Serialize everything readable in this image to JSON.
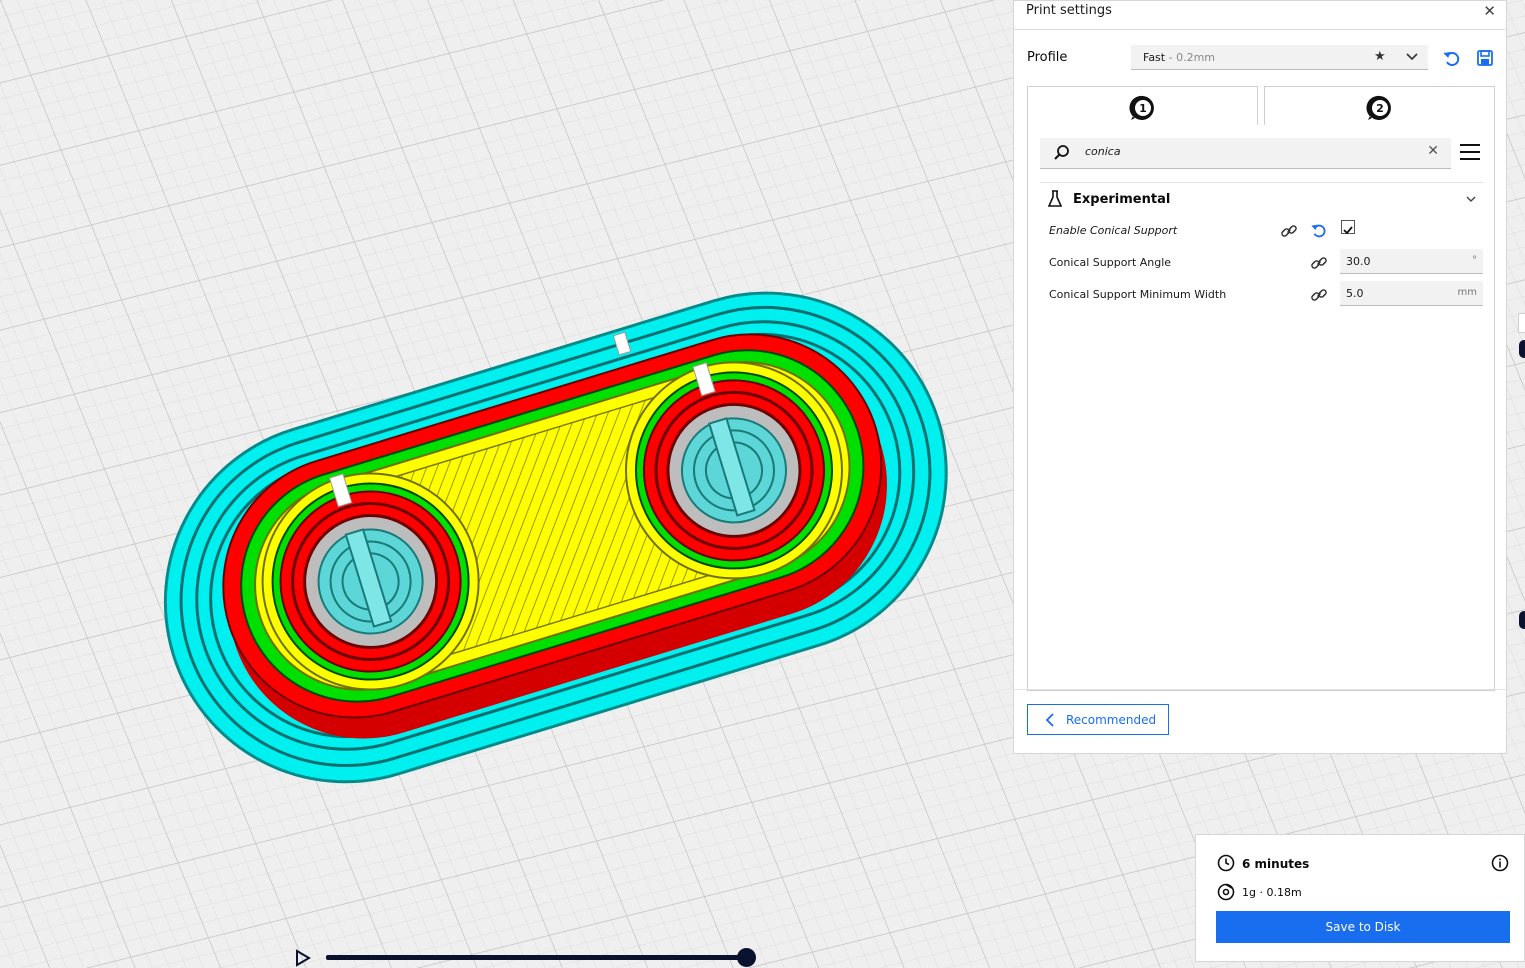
{
  "panel": {
    "title": "Print settings",
    "close_glyph": "✕",
    "profile_label": "Profile",
    "profile_name": "Fast",
    "profile_layer": " - 0.2mm",
    "extruders": [
      "1",
      "2"
    ],
    "search": {
      "value": "conica",
      "clear_glyph": "✕"
    },
    "category": "Experimental",
    "settings": [
      {
        "label": "Enable Conical Support",
        "type": "checkbox",
        "checked": true
      },
      {
        "label": "Conical Support Angle",
        "value": "30.0",
        "unit": "°"
      },
      {
        "label": "Conical Support Minimum Width",
        "value": "5.0",
        "unit": "mm"
      }
    ],
    "recommended_label": "Recommended",
    "grip": "....",
    "icons": [
      "star-icon",
      "chevron-down-icon",
      "reset-icon",
      "save-icon",
      "search-icon",
      "menu-icon",
      "flask-icon",
      "link-icon"
    ]
  },
  "estimate": {
    "time": "6 minutes",
    "material": "1g · 0.18m",
    "save_label": "Save to Disk",
    "icons": [
      "clock-icon",
      "info-icon",
      "spool-icon"
    ]
  },
  "colors": {
    "accent": "#196ef0",
    "skirt": "#00f0f0",
    "wall_outer": "#ff0000",
    "wall_inner": "#00e000",
    "infill": "#ffff00",
    "support": "#5cd6d6",
    "slider": "#0b1230"
  },
  "layer_slider": {
    "position": 1.0
  }
}
